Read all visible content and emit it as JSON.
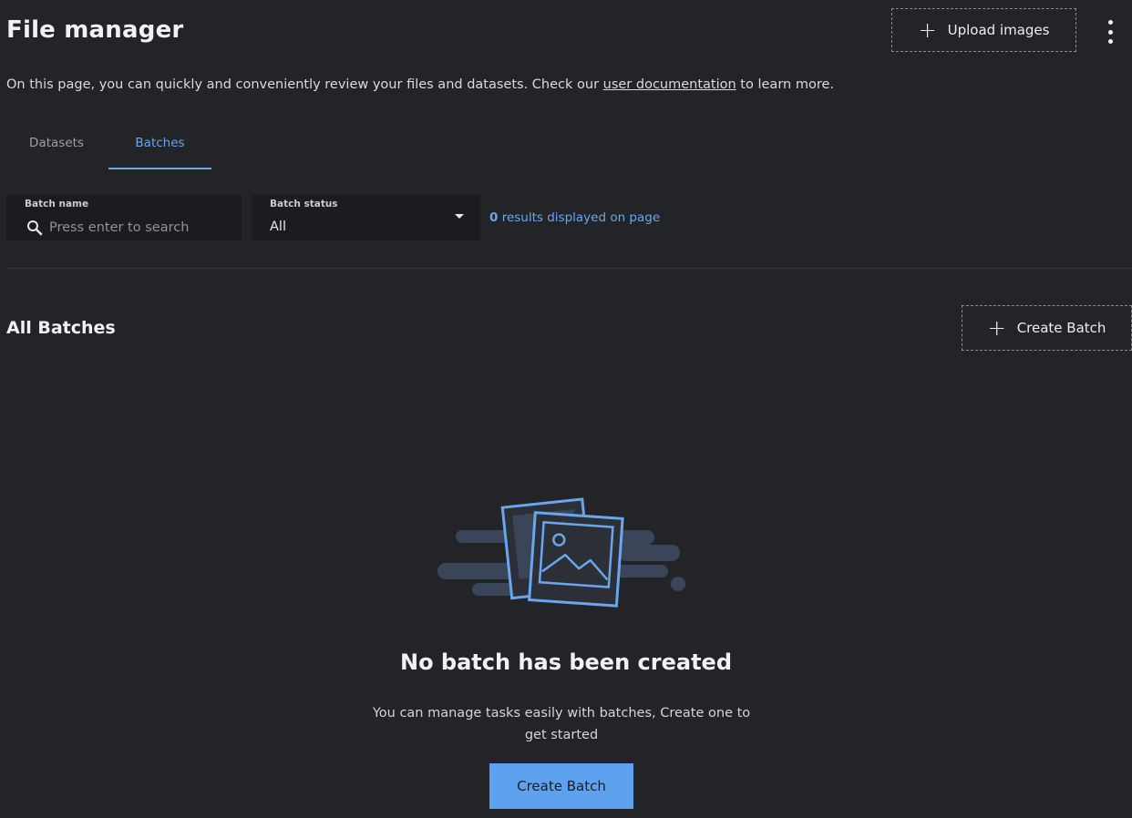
{
  "header": {
    "title": "File manager",
    "upload_label": "Upload images",
    "upload_icon": "plus-icon",
    "more_icon": "kebab-menu-icon"
  },
  "intro": {
    "before_link": "On this page, you can quickly and conveniently review your files and datasets. Check our ",
    "link_text": "user documentation",
    "after_link": " to learn more."
  },
  "tabs": [
    {
      "label": "Datasets",
      "active": false
    },
    {
      "label": "Batches",
      "active": true
    }
  ],
  "filters": {
    "batch_name": {
      "label": "Batch name",
      "value": "",
      "placeholder": "Press enter to search",
      "icon": "search-icon"
    },
    "batch_status": {
      "label": "Batch status",
      "value": "All",
      "icon": "caret-down-icon"
    },
    "results": {
      "count": "0",
      "suffix": " results displayed on page"
    }
  },
  "section": {
    "title": "All Batches",
    "create_label": "Create Batch"
  },
  "empty_state": {
    "illustration_icon": "image-gallery-icon",
    "title": "No batch has been created",
    "description": "You can manage tasks easily with batches, Create one to get started",
    "button_label": "Create Batch"
  },
  "colors": {
    "background": "#232428",
    "field_background": "#1b1c1f",
    "accent": "#6aa6ef",
    "primary_button": "#5ea2ef"
  }
}
